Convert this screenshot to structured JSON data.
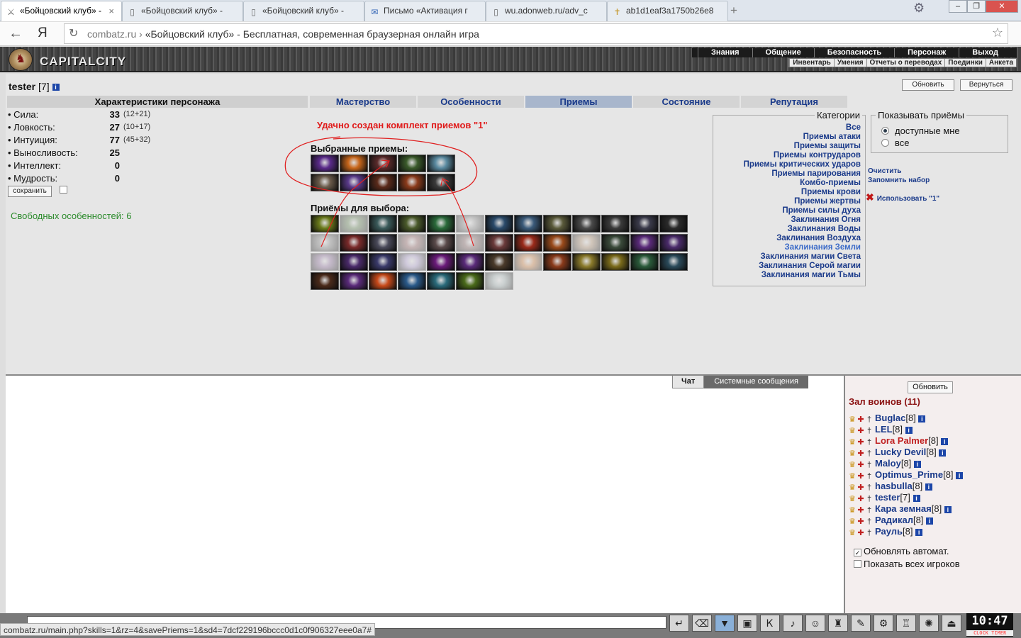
{
  "browser": {
    "tabs": [
      {
        "title": "«Бойцовский клуб» -",
        "icon": "crossed-swords-icon",
        "active": true
      },
      {
        "title": "«Бойцовский клуб» -",
        "icon": "page-icon",
        "active": false
      },
      {
        "title": "«Бойцовский клуб» -",
        "icon": "page-icon",
        "active": false
      },
      {
        "title": "Письмо «Активация г",
        "icon": "mail-icon",
        "active": false
      },
      {
        "title": "wu.adonweb.ru/adv_c",
        "icon": "page-icon",
        "active": false
      },
      {
        "title": "ab1d1eaf3a1750b26e8",
        "icon": "cross-icon",
        "active": false
      }
    ],
    "new_tab": "+",
    "address_host": "combatz.ru",
    "address_sep": "›",
    "address_title": "«Бойцовский клуб» - Бесплатная, современная браузерная онлайн игра",
    "yandex": "Я",
    "status_url": "combatz.ru/main.php?skills=1&rz=4&savePriems=1&sd4=7dcf229196bccc0d1c0f906327eee0a7#"
  },
  "header": {
    "logo_text": "CAPITALCITY",
    "menu": [
      "Знания",
      "Общение",
      "Безопасность",
      "Персонаж",
      "Выход"
    ],
    "submenu": [
      "Инвентарь",
      "Умения",
      "Отчеты о переводах",
      "Поединки",
      "Анкета"
    ]
  },
  "character": {
    "name": "tester",
    "level": "[7]",
    "refresh_label": "Обновить",
    "back_label": "Вернуться",
    "stats_title": "Характеристики персонажа",
    "stats": [
      {
        "label": "• Сила:",
        "value": "33",
        "sub": "(12+21)"
      },
      {
        "label": "• Ловкость:",
        "value": "27",
        "sub": "(10+17)"
      },
      {
        "label": "• Интуиция:",
        "value": "77",
        "sub": "(45+32)"
      },
      {
        "label": "• Выносливость:",
        "value": "25",
        "sub": ""
      },
      {
        "label": "• Интеллект:",
        "value": "0",
        "sub": ""
      },
      {
        "label": "• Мудрость:",
        "value": "0",
        "sub": ""
      }
    ],
    "save_label": "сохранить",
    "free_features": "Свободных особенностей: 6"
  },
  "tabs": [
    "Мастерство",
    "Особенности",
    "Приемы",
    "Состояние",
    "Репутация"
  ],
  "active_tab": "Приемы",
  "skills": {
    "success": "Удачно создан комплект приемов \"1\"",
    "chosen_title": "Выбранные приемы:",
    "available_title": "Приёмы для выбора:",
    "chosen_colors": [
      "#5a2a8a",
      "#c8661a",
      "#5a2a2a",
      "#3a5a2a",
      "#5a8aa0",
      "#6a5a4a",
      "#5a3a8a",
      "#5a2a1a",
      "#8a3a1a",
      "#3a3a3a"
    ],
    "available": [
      {
        "c": "#6a7a1a",
        "dim": false
      },
      {
        "c": "#5a7a4a",
        "dim": true
      },
      {
        "c": "#3a5a5a",
        "dim": false
      },
      {
        "c": "#4a5a2a",
        "dim": false
      },
      {
        "c": "#2a6a3a",
        "dim": false
      },
      {
        "c": "#8a8a8a",
        "dim": true
      },
      {
        "c": "#2a4a6a",
        "dim": false
      },
      {
        "c": "#3a5a7a",
        "dim": false
      },
      {
        "c": "#5a5a3a",
        "dim": false
      },
      {
        "c": "#4a4a4a",
        "dim": false
      },
      {
        "c": "#3a3a3a",
        "dim": false
      },
      {
        "c": "#3a3a4a",
        "dim": false
      },
      {
        "c": "#2a2a2a",
        "dim": false
      },
      {
        "c": "#7a7a7a",
        "dim": true
      },
      {
        "c": "#7a2a2a",
        "dim": false
      },
      {
        "c": "#4a4a5a",
        "dim": false
      },
      {
        "c": "#8a5a5a",
        "dim": true
      },
      {
        "c": "#5a4a4a",
        "dim": false
      },
      {
        "c": "#7a5a5a",
        "dim": true
      },
      {
        "c": "#6a3a3a",
        "dim": false
      },
      {
        "c": "#9a2a1a",
        "dim": false
      },
      {
        "c": "#9a4a1a",
        "dim": false
      },
      {
        "c": "#aa8a6a",
        "dim": true
      },
      {
        "c": "#3a4a3a",
        "dim": false
      },
      {
        "c": "#5a2a7a",
        "dim": false
      },
      {
        "c": "#4a2a6a",
        "dim": false
      },
      {
        "c": "#8a6a9a",
        "dim": true
      },
      {
        "c": "#4a2a6a",
        "dim": false
      },
      {
        "c": "#3a3a6a",
        "dim": false
      },
      {
        "c": "#aa9acc",
        "dim": true
      },
      {
        "c": "#6a1a7a",
        "dim": false
      },
      {
        "c": "#5a2a7a",
        "dim": false
      },
      {
        "c": "#4a3a2a",
        "dim": false
      },
      {
        "c": "#c87a3a",
        "dim": true
      },
      {
        "c": "#8a3a1a",
        "dim": false
      },
      {
        "c": "#8a7a2a",
        "dim": false
      },
      {
        "c": "#7a6a1a",
        "dim": false
      },
      {
        "c": "#2a5a3a",
        "dim": false
      },
      {
        "c": "#2a4a5a",
        "dim": false
      },
      {
        "c": "#4a2a1a",
        "dim": false
      },
      {
        "c": "#5a2a7a",
        "dim": false
      },
      {
        "c": "#c84a1a",
        "dim": false
      },
      {
        "c": "#2a5a8a",
        "dim": false
      },
      {
        "c": "#2a6a7a",
        "dim": false
      },
      {
        "c": "#4a6a1a",
        "dim": false
      },
      {
        "c": "#9aaaaa",
        "dim": true
      }
    ]
  },
  "categories": {
    "legend": "Категории",
    "items": [
      "Все",
      "Приемы атаки",
      "Приемы защиты",
      "Приемы контрударов",
      "Приемы критических ударов",
      "Приемы парирования",
      "Комбо-приемы",
      "Приемы крови",
      "Приемы жертвы",
      "Приемы силы духа",
      "Заклинания Огня",
      "Заклинания Воды",
      "Заклинания Воздуха",
      "Заклинания Земли",
      "Заклинания магии Света",
      "Заклинания Серой магии",
      "Заклинания магии Тьмы"
    ],
    "highlighted": "Заклинания Земли"
  },
  "show_skills": {
    "legend": "Показывать приёмы",
    "options": [
      "доступные мне",
      "все"
    ],
    "selected": "доступные мне"
  },
  "actions": {
    "clear": "Очистить",
    "remember": "Запомнить набор",
    "use_set": "Использовать \"1\""
  },
  "chat": {
    "tab_chat": "Чат",
    "tab_system": "Системные сообщения"
  },
  "roster": {
    "refresh_label": "Обновить",
    "title": "Зал воинов (11)",
    "players": [
      {
        "name": "Buglac",
        "level": "[8]",
        "red": false
      },
      {
        "name": "LEL",
        "level": "[8]",
        "red": false
      },
      {
        "name": "Lora Palmer",
        "level": "[8]",
        "red": true
      },
      {
        "name": "Lucky Devil",
        "level": "[8]",
        "red": false
      },
      {
        "name": "Maloy",
        "level": "[8]",
        "red": false
      },
      {
        "name": "Optimus_Prime",
        "level": "[8]",
        "red": false
      },
      {
        "name": "hasbulla",
        "level": "[8]",
        "red": false
      },
      {
        "name": "tester",
        "level": "[7]",
        "red": false
      },
      {
        "name": "Кара земная",
        "level": "[8]",
        "red": false
      },
      {
        "name": "Радикал",
        "level": "[8]",
        "red": false
      },
      {
        "name": "Рауль",
        "level": "[8]",
        "red": false
      }
    ],
    "auto_refresh": "Обновлять автомат.",
    "show_all": "Показать всех игроков"
  },
  "bottom": {
    "clock": "10:47",
    "clock_sub": "CLOCK  TIMER",
    "icons": [
      "enter-icon",
      "eraser-icon",
      "filter-icon",
      "save-icon",
      "translit-icon",
      "music-icon",
      "smile-icon",
      "bag-icon",
      "scroll-icon",
      "gear-icon",
      "lock-icon",
      "bug-icon",
      "exit-icon"
    ]
  },
  "colors": {
    "link": "#1a3a8a",
    "success": "#e01a1a",
    "free": "#2a8a2a",
    "roster_title": "#8a1010",
    "active_tab": "#a8b6cc"
  }
}
